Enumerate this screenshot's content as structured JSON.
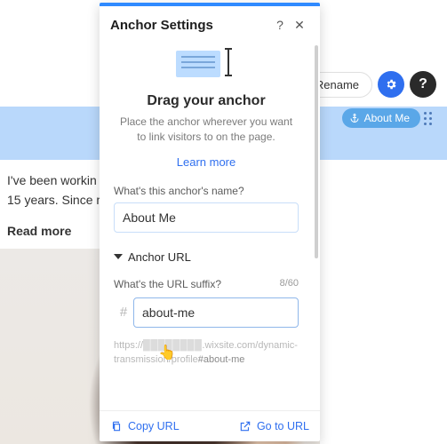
{
  "background": {
    "paragraph_line1": "I've been workin",
    "paragraph_line2": "15 years. Since m",
    "read_more": "Read more"
  },
  "toolbar": {
    "rename": "Rename",
    "settings_icon": "gear-icon",
    "help_icon": "question-icon",
    "anchor_chip_label": "About Me"
  },
  "modal": {
    "title": "Anchor Settings",
    "help_icon": "?",
    "close_icon": "✕",
    "heading": "Drag your anchor",
    "subtext": "Place the anchor wherever you want to link visitors to on the page.",
    "learn_more": "Learn more",
    "name_label": "What's this anchor's name?",
    "name_value": "About Me",
    "url_section_label": "Anchor URL",
    "suffix_label": "What's the URL suffix?",
    "suffix_value": "about-me",
    "suffix_counter": "8/60",
    "full_url_prefix": "https://",
    "full_url_blur": "████████",
    "full_url_mid": ".wixsite.com/dynamic-transmission/profile",
    "full_url_hash": "#about-me",
    "copy_url": "Copy URL",
    "go_to_url": "Go to URL"
  }
}
